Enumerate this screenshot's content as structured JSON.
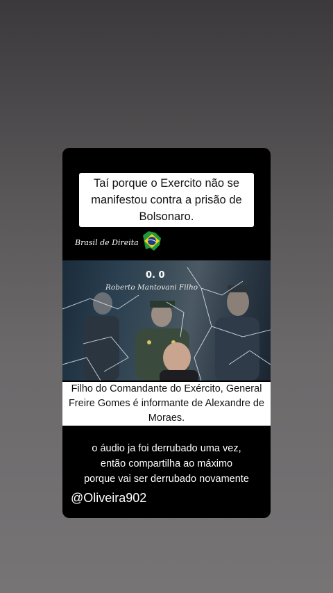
{
  "post": {
    "headline": "Taí porque o Exercito não se manifestou contra a prisão de Bolsonaro.",
    "logo": {
      "text": "Brasil de Direita",
      "icon": "brazil-flag-icon"
    },
    "photo": {
      "code": "0. 0",
      "credit": "Roberto Mantovani Filho"
    },
    "caption_lines": [
      "Filho do Comandante do Exército, General",
      "Freire Gomes é informante de Alexandre de",
      "Moraes."
    ],
    "body_lines": [
      "o áudio ja foi derrubado uma vez,",
      "então compartilha ao máximo",
      "porque vai ser derrubado novamente"
    ],
    "handle": "@Oliveira902"
  },
  "colors": {
    "background": "#5a5859",
    "card": "#000000",
    "label_bg": "#ffffff",
    "flag_green": "#1f9a3a",
    "flag_yellow": "#f2d21b",
    "flag_blue": "#1f3b8a"
  }
}
